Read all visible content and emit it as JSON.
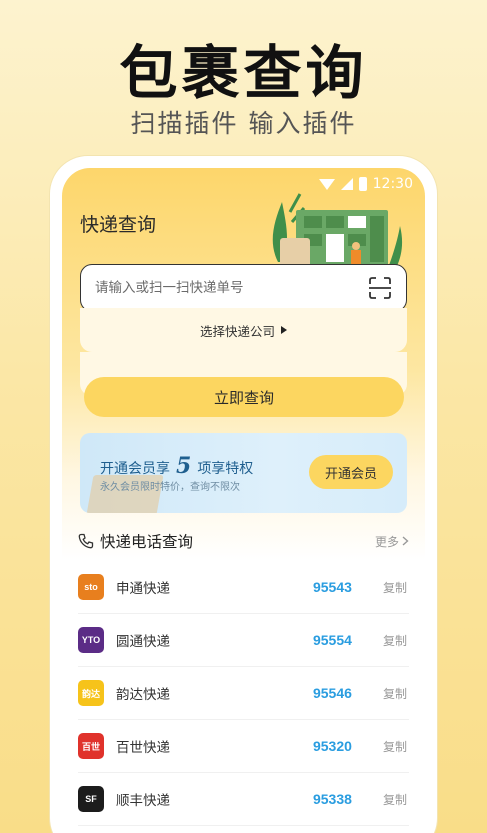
{
  "promo": {
    "headline": "包裹查询",
    "subline": "扫描插件 输入插件"
  },
  "status_bar": {
    "time": "12:30"
  },
  "app": {
    "title": "快递查询",
    "search_placeholder": "请输入或扫一扫快递单号",
    "select_company": "选择快递公司",
    "query_button": "立即查询"
  },
  "vip": {
    "title_prefix": "开通会员享",
    "title_number": "5",
    "title_suffix": "项享特权",
    "subtitle": "永久会员限时特价，查询不限次",
    "button": "开通会员"
  },
  "phone_section": {
    "title": "快递电话查询",
    "more": "更多",
    "copy_label": "复制",
    "companies": [
      {
        "name": "申通快递",
        "phone": "95543",
        "logo_text": "sto",
        "logo_color": "#e87f1e"
      },
      {
        "name": "圆通快递",
        "phone": "95554",
        "logo_text": "YTO",
        "logo_color": "#5b2c86"
      },
      {
        "name": "韵达快递",
        "phone": "95546",
        "logo_text": "韵达",
        "logo_color": "#f6c31a"
      },
      {
        "name": "百世快递",
        "phone": "95320",
        "logo_text": "百世",
        "logo_color": "#e0322b"
      },
      {
        "name": "顺丰快递",
        "phone": "95338",
        "logo_text": "SF",
        "logo_color": "#1c1c1c"
      }
    ]
  },
  "colors": {
    "accent": "#fcd660",
    "link_blue": "#2a9de0",
    "vip_blue": "#1f5f8f"
  }
}
